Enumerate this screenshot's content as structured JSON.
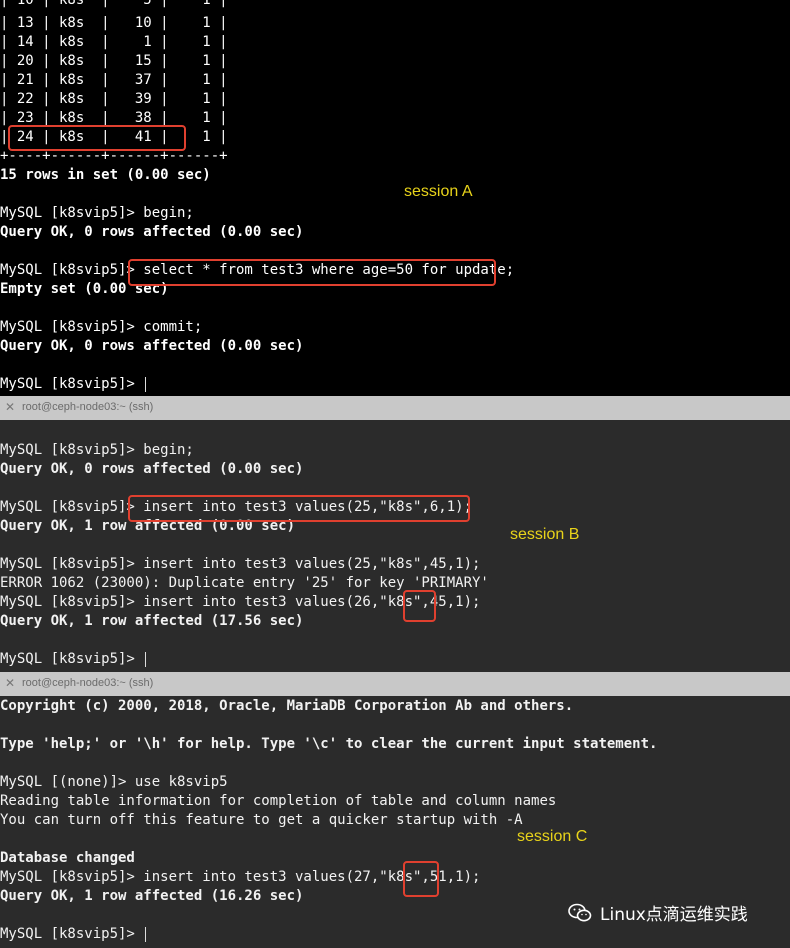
{
  "sessionA": {
    "lines": [
      "| 10 | k8s  |    5 |    1 |",
      "| 13 | k8s  |   10 |    1 |",
      "| 14 | k8s  |    1 |    1 |",
      "| 20 | k8s  |   15 |    1 |",
      "| 21 | k8s  |   37 |    1 |",
      "| 22 | k8s  |   39 |    1 |",
      "| 23 | k8s  |   38 |    1 |",
      "| 24 | k8s  |   41 |    1 |",
      "+----+------+------+------+",
      "15 rows in set (0.00 sec)",
      "",
      "MySQL [k8svip5]> begin;",
      "Query OK, 0 rows affected (0.00 sec)",
      "",
      "MySQL [k8svip5]> select * from test3 where age=50 for update;",
      "Empty set (0.00 sec)",
      "",
      "MySQL [k8svip5]> commit;",
      "Query OK, 0 rows affected (0.00 sec)",
      "",
      "MySQL [k8svip5]> "
    ],
    "label": "session A"
  },
  "tabs": {
    "tab1_title": "root@ceph-node03:~ (ssh)",
    "tab2_title": "root@ceph-node03:~ (ssh)",
    "close_glyph": "✕"
  },
  "sessionB": {
    "lines": [
      "",
      "MySQL [k8svip5]> begin;",
      "Query OK, 0 rows affected (0.00 sec)",
      "",
      "MySQL [k8svip5]> insert into test3 values(25,\"k8s\",6,1);",
      "Query OK, 1 row affected (0.00 sec)",
      "",
      "MySQL [k8svip5]> insert into test3 values(25,\"k8s\",45,1);",
      "ERROR 1062 (23000): Duplicate entry '25' for key 'PRIMARY'",
      "MySQL [k8svip5]> insert into test3 values(26,\"k8s\",45,1);",
      "Query OK, 1 row affected (17.56 sec)",
      "",
      "MySQL [k8svip5]> "
    ],
    "label": "session B"
  },
  "sessionC": {
    "lines": [
      "Copyright (c) 2000, 2018, Oracle, MariaDB Corporation Ab and others.",
      "",
      "Type 'help;' or '\\h' for help. Type '\\c' to clear the current input statement.",
      "",
      "MySQL [(none)]> use k8svip5",
      "Reading table information for completion of table and column names",
      "You can turn off this feature to get a quicker startup with -A",
      "",
      "Database changed",
      "MySQL [k8svip5]> insert into test3 values(27,\"k8s\",51,1);",
      "Query OK, 1 row affected (16.26 sec)",
      "",
      "MySQL [k8svip5]> "
    ],
    "label": "session C"
  },
  "watermark": {
    "text": "Linux点滴运维实践",
    "icon": "wechat-icon"
  }
}
